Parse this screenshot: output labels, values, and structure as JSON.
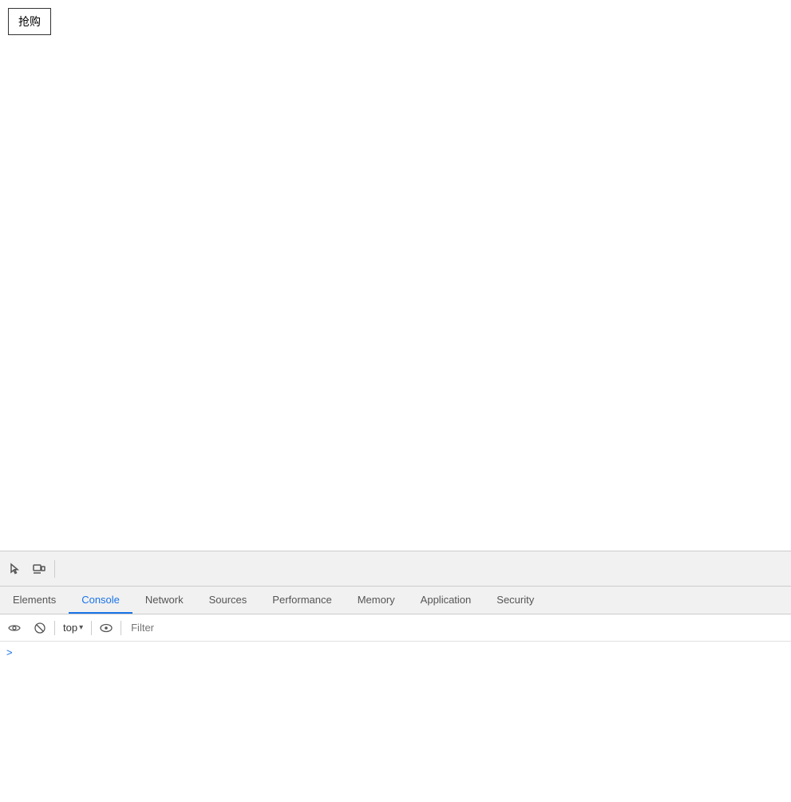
{
  "page": {
    "buy_button_label": "抢购"
  },
  "devtools": {
    "toolbar": {
      "inspect_icon": "⊹",
      "device_icon": "▭"
    },
    "tabs": [
      {
        "id": "elements",
        "label": "Elements",
        "active": false
      },
      {
        "id": "console",
        "label": "Console",
        "active": true
      },
      {
        "id": "network",
        "label": "Network",
        "active": false
      },
      {
        "id": "sources",
        "label": "Sources",
        "active": false
      },
      {
        "id": "performance",
        "label": "Performance",
        "active": false
      },
      {
        "id": "memory",
        "label": "Memory",
        "active": false
      },
      {
        "id": "application",
        "label": "Application",
        "active": false
      },
      {
        "id": "security",
        "label": "Security",
        "active": false
      }
    ],
    "console": {
      "create_live_expression_icon": "▶",
      "clear_console_icon": "⊘",
      "context_selector": "top",
      "context_arrow": "▾",
      "show_issues_icon": "👁",
      "filter_placeholder": "Filter",
      "prompt_caret": ">"
    }
  }
}
